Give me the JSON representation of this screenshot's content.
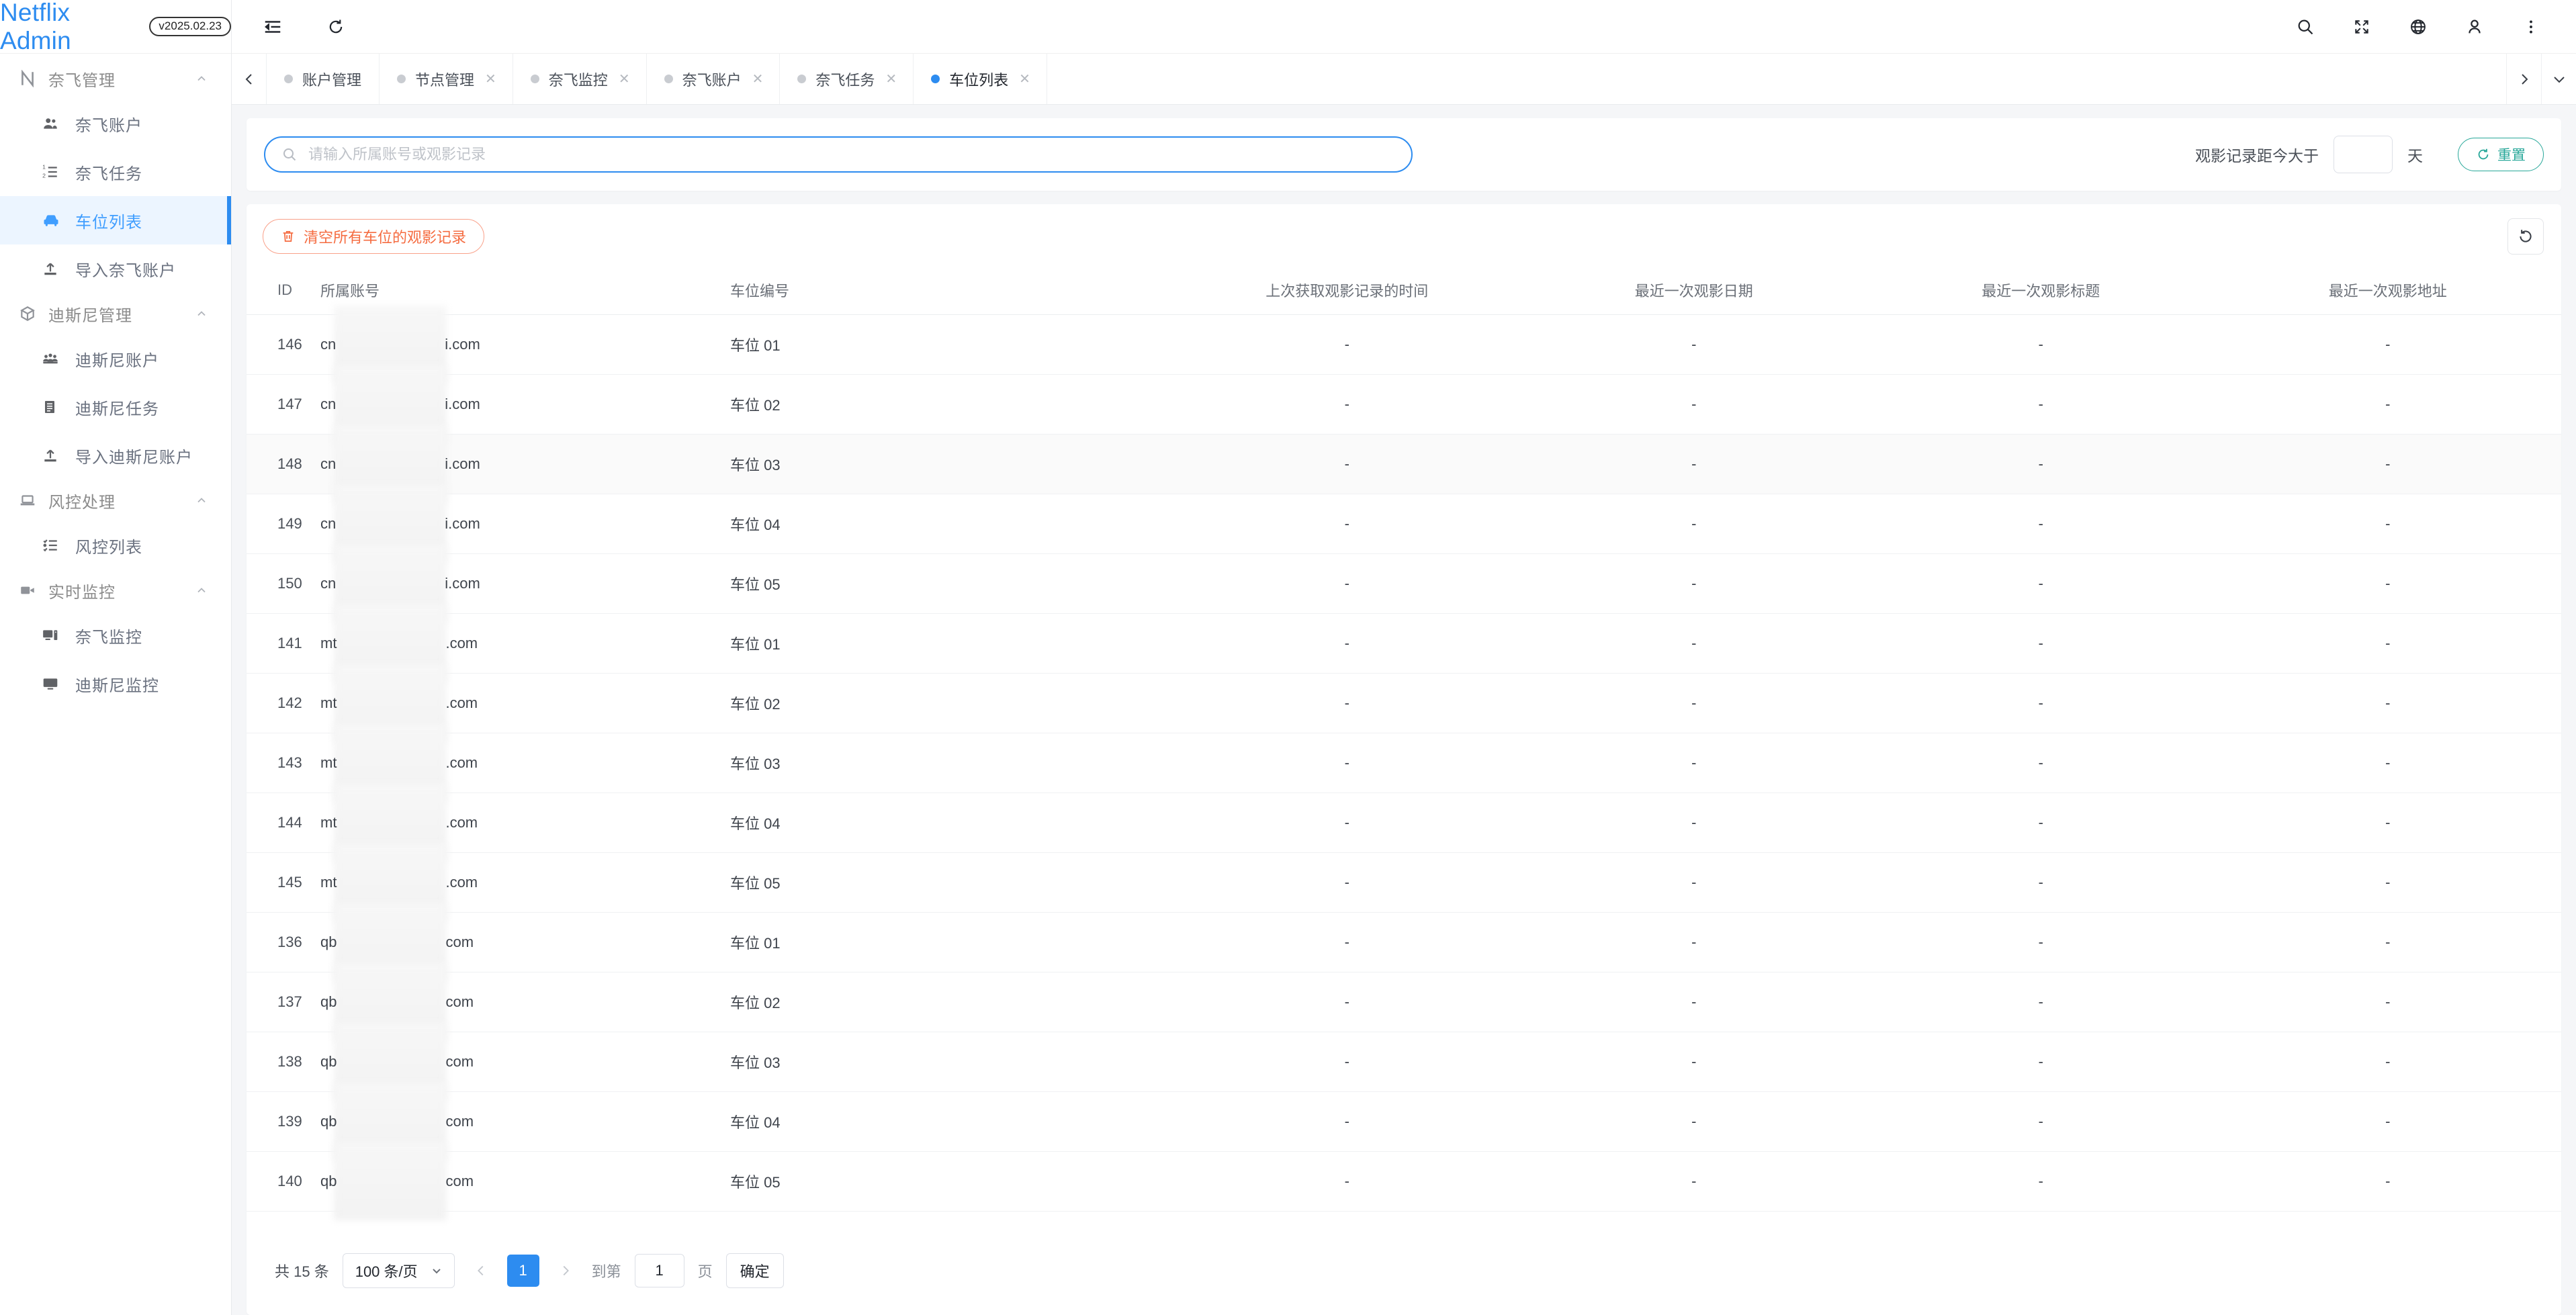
{
  "brand": {
    "name": "Netflix Admin",
    "version": "v2025.02.23",
    "accent": "#2d8cf0"
  },
  "sidebar": {
    "groups": [
      {
        "title": "奈飞管理",
        "icon": "netflix-n-icon",
        "items": [
          {
            "label": "奈飞账户",
            "icon": "users-icon",
            "active": false
          },
          {
            "label": "奈飞任务",
            "icon": "ordered-list-icon",
            "active": false
          },
          {
            "label": "车位列表",
            "icon": "car-icon",
            "active": true
          },
          {
            "label": "导入奈飞账户",
            "icon": "upload-icon",
            "active": false
          }
        ]
      },
      {
        "title": "迪斯尼管理",
        "icon": "cube-icon",
        "items": [
          {
            "label": "迪斯尼账户",
            "icon": "group-icon",
            "active": false
          },
          {
            "label": "迪斯尼任务",
            "icon": "document-icon",
            "active": false
          },
          {
            "label": "导入迪斯尼账户",
            "icon": "upload-icon",
            "active": false
          }
        ]
      },
      {
        "title": "风控处理",
        "icon": "laptop-icon",
        "items": [
          {
            "label": "风控列表",
            "icon": "checklist-icon",
            "active": false
          }
        ]
      },
      {
        "title": "实时监控",
        "icon": "video-camera-icon",
        "items": [
          {
            "label": "奈飞监控",
            "icon": "monitor-icon",
            "active": false
          },
          {
            "label": "迪斯尼监控",
            "icon": "display-icon",
            "active": false
          }
        ]
      }
    ]
  },
  "topbar": {
    "left_icons": [
      {
        "name": "collapse-menu-icon"
      },
      {
        "name": "refresh-icon"
      }
    ],
    "right_icons": [
      {
        "name": "search-icon"
      },
      {
        "name": "fullscreen-icon"
      },
      {
        "name": "language-globe-icon"
      },
      {
        "name": "user-avatar-icon"
      },
      {
        "name": "more-vertical-icon"
      }
    ]
  },
  "tabs": {
    "items": [
      {
        "label": "账户管理",
        "active": false,
        "closable": false
      },
      {
        "label": "节点管理",
        "active": false,
        "closable": true
      },
      {
        "label": "奈飞监控",
        "active": false,
        "closable": true
      },
      {
        "label": "奈飞账户",
        "active": false,
        "closable": true
      },
      {
        "label": "奈飞任务",
        "active": false,
        "closable": true
      },
      {
        "label": "车位列表",
        "active": true,
        "closable": true
      }
    ],
    "close_glyph": "✕"
  },
  "filter": {
    "search_placeholder": "请输入所属账号或观影记录",
    "search_value": "",
    "days_label": "观影记录距今大于",
    "days_value": "",
    "days_unit": "天",
    "reset_label": "重置"
  },
  "toolbar": {
    "clear_all_label": "清空所有车位的观影记录",
    "refresh_name": "refresh-table-icon"
  },
  "table": {
    "columns": [
      "ID",
      "所属账号",
      "车位编号",
      "上次获取观影记录的时间",
      "最近一次观影日期",
      "最近一次观影标题",
      "最近一次观影地址"
    ],
    "empty_value": "-",
    "rows": [
      {
        "id": "146",
        "account_prefix": "cn",
        "account_suffix": "i.com",
        "slot": "车位 01",
        "last_fetch": "-",
        "last_date": "-",
        "last_title": "-",
        "last_addr": "-"
      },
      {
        "id": "147",
        "account_prefix": "cn",
        "account_suffix": "i.com",
        "slot": "车位 02",
        "last_fetch": "-",
        "last_date": "-",
        "last_title": "-",
        "last_addr": "-"
      },
      {
        "id": "148",
        "account_prefix": "cn",
        "account_suffix": "i.com",
        "slot": "车位 03",
        "last_fetch": "-",
        "last_date": "-",
        "last_title": "-",
        "last_addr": "-"
      },
      {
        "id": "149",
        "account_prefix": "cn",
        "account_suffix": "i.com",
        "slot": "车位 04",
        "last_fetch": "-",
        "last_date": "-",
        "last_title": "-",
        "last_addr": "-"
      },
      {
        "id": "150",
        "account_prefix": "cn",
        "account_suffix": "i.com",
        "slot": "车位 05",
        "last_fetch": "-",
        "last_date": "-",
        "last_title": "-",
        "last_addr": "-"
      },
      {
        "id": "141",
        "account_prefix": "mt",
        "account_suffix": ".com",
        "slot": "车位 01",
        "last_fetch": "-",
        "last_date": "-",
        "last_title": "-",
        "last_addr": "-"
      },
      {
        "id": "142",
        "account_prefix": "mt",
        "account_suffix": ".com",
        "slot": "车位 02",
        "last_fetch": "-",
        "last_date": "-",
        "last_title": "-",
        "last_addr": "-"
      },
      {
        "id": "143",
        "account_prefix": "mt",
        "account_suffix": ".com",
        "slot": "车位 03",
        "last_fetch": "-",
        "last_date": "-",
        "last_title": "-",
        "last_addr": "-"
      },
      {
        "id": "144",
        "account_prefix": "mt",
        "account_suffix": ".com",
        "slot": "车位 04",
        "last_fetch": "-",
        "last_date": "-",
        "last_title": "-",
        "last_addr": "-"
      },
      {
        "id": "145",
        "account_prefix": "mt",
        "account_suffix": ".com",
        "slot": "车位 05",
        "last_fetch": "-",
        "last_date": "-",
        "last_title": "-",
        "last_addr": "-"
      },
      {
        "id": "136",
        "account_prefix": "qb",
        "account_suffix": "com",
        "slot": "车位 01",
        "last_fetch": "-",
        "last_date": "-",
        "last_title": "-",
        "last_addr": "-"
      },
      {
        "id": "137",
        "account_prefix": "qb",
        "account_suffix": "com",
        "slot": "车位 02",
        "last_fetch": "-",
        "last_date": "-",
        "last_title": "-",
        "last_addr": "-"
      },
      {
        "id": "138",
        "account_prefix": "qb",
        "account_suffix": "com",
        "slot": "车位 03",
        "last_fetch": "-",
        "last_date": "-",
        "last_title": "-",
        "last_addr": "-"
      },
      {
        "id": "139",
        "account_prefix": "qb",
        "account_suffix": "com",
        "slot": "车位 04",
        "last_fetch": "-",
        "last_date": "-",
        "last_title": "-",
        "last_addr": "-"
      },
      {
        "id": "140",
        "account_prefix": "qb",
        "account_suffix": "com",
        "slot": "车位 05",
        "last_fetch": "-",
        "last_date": "-",
        "last_title": "-",
        "last_addr": "-"
      }
    ]
  },
  "pagination": {
    "total_label": "共 15 条",
    "page_size_label": "100 条/页",
    "current_page": "1",
    "jump_label": "到第",
    "jump_value": "1",
    "page_unit": "页",
    "confirm_label": "确定"
  }
}
